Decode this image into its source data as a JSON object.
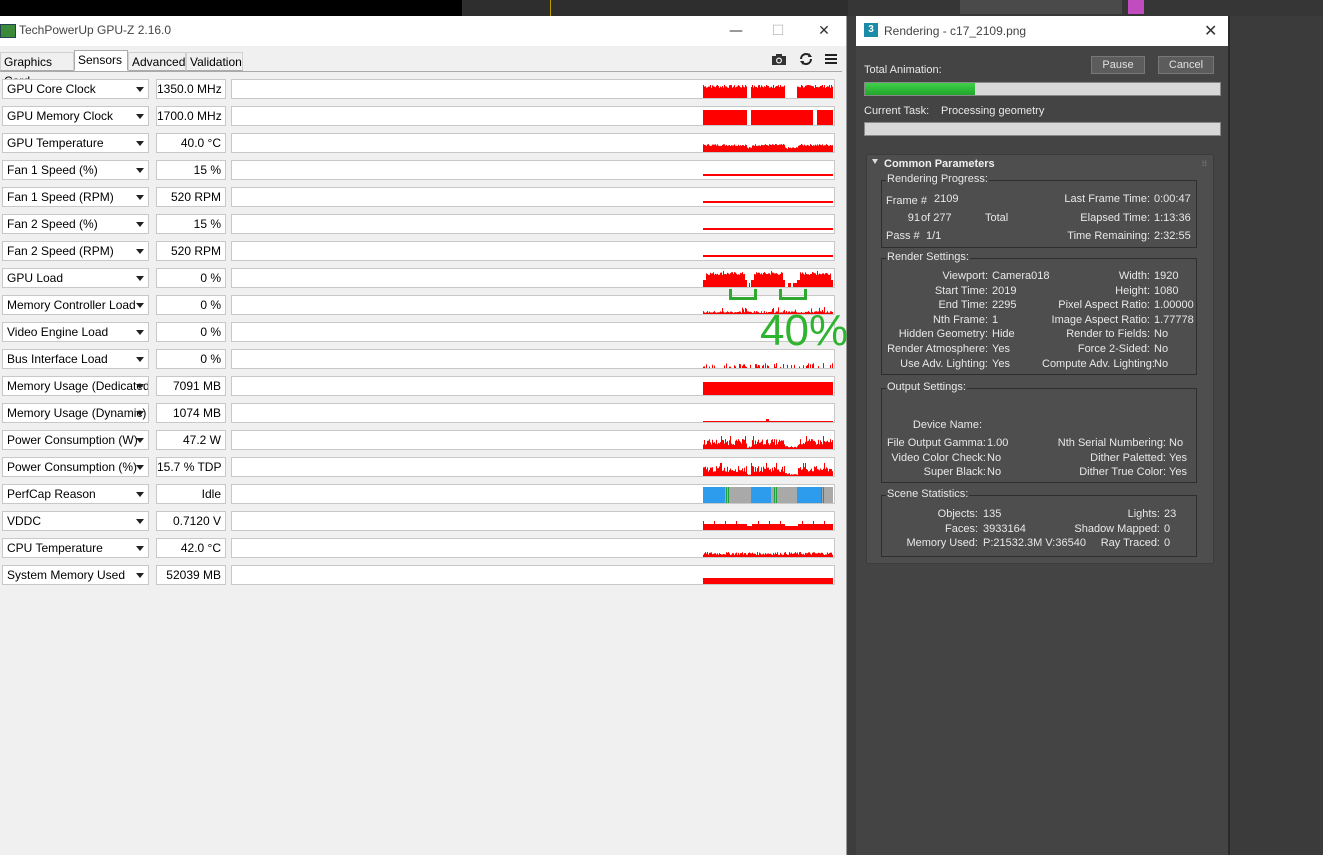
{
  "gpuz": {
    "title": "TechPowerUp GPU-Z 2.16.0",
    "window_buttons": {
      "minimize": "—",
      "maximize": "☐",
      "close": "✕"
    },
    "tabs": [
      {
        "label": "Graphics Card",
        "active": false
      },
      {
        "label": "Sensors",
        "active": true
      },
      {
        "label": "Advanced",
        "active": false
      },
      {
        "label": "Validation",
        "active": false
      }
    ],
    "toolbar_icons": [
      "camera-icon",
      "refresh-icon",
      "menu-icon"
    ],
    "graph_color": "#ff0000",
    "perfcap_colors": {
      "blue": "#2e9cec",
      "gray": "#a9a9a9",
      "green": "#20a040"
    },
    "sensors": [
      {
        "name": "GPU Core Clock",
        "value": "1350.0 MHz",
        "graph": "blocks"
      },
      {
        "name": "GPU Memory Clock",
        "value": "1700.0 MHz",
        "graph": "blocks_full"
      },
      {
        "name": "GPU Temperature",
        "value": "40.0 °C",
        "graph": "noisy_low"
      },
      {
        "name": "Fan 1 Speed (%)",
        "value": "15 %",
        "graph": "flat"
      },
      {
        "name": "Fan 1 Speed (RPM)",
        "value": "520 RPM",
        "graph": "flat"
      },
      {
        "name": "Fan 2 Speed (%)",
        "value": "15 %",
        "graph": "flat"
      },
      {
        "name": "Fan 2 Speed (RPM)",
        "value": "520 RPM",
        "graph": "flat"
      },
      {
        "name": "GPU Load",
        "value": "0 %",
        "graph": "load"
      },
      {
        "name": "Memory Controller Load",
        "value": "0 %",
        "graph": "memctl"
      },
      {
        "name": "Video Engine Load",
        "value": "0 %",
        "graph": "none"
      },
      {
        "name": "Bus Interface Load",
        "value": "0 %",
        "graph": "sparse"
      },
      {
        "name": "Memory Usage (Dedicated)",
        "value": "7091 MB",
        "graph": "solid_tall"
      },
      {
        "name": "Memory Usage (Dynamic)",
        "value": "1074 MB",
        "graph": "thin"
      },
      {
        "name": "Power Consumption (W)",
        "value": "47.2 W",
        "graph": "power"
      },
      {
        "name": "Power Consumption (%)",
        "value": "15.7 % TDP",
        "graph": "power"
      },
      {
        "name": "PerfCap Reason",
        "value": "Idle",
        "graph": "perfcap"
      },
      {
        "name": "VDDC",
        "value": "0.7120 V",
        "graph": "vddc"
      },
      {
        "name": "CPU Temperature",
        "value": "42.0 °C",
        "graph": "noisy_tiny"
      },
      {
        "name": "System Memory Used",
        "value": "52039 MB",
        "graph": "solid_mid"
      }
    ],
    "overlay_text": "40%",
    "overlay_color": "#2fb42f"
  },
  "render": {
    "title": "Rendering - c17_2109.png",
    "total_animation_label": "Total Animation:",
    "total_animation_progress": 0.31,
    "current_task_label": "Current Task:",
    "current_task_value": "Processing geometry",
    "current_task_progress": 0,
    "pause_label": "Pause",
    "cancel_label": "Cancel",
    "common_params_label": "Common Parameters",
    "rendering_progress": {
      "title": "Rendering Progress:",
      "frame_label": "Frame #",
      "frame_value": "2109",
      "count_value": "91",
      "count_of": "of 277",
      "total_label": "Total",
      "pass_label": "Pass #",
      "pass_value": "1/1",
      "last_frame_label": "Last Frame Time:",
      "last_frame_value": "0:00:47",
      "elapsed_label": "Elapsed Time:",
      "elapsed_value": "1:13:36",
      "remaining_label": "Time Remaining:",
      "remaining_value": "2:32:55"
    },
    "render_settings": {
      "title": "Render Settings:",
      "left": [
        {
          "k": "Viewport:",
          "v": "Camera018"
        },
        {
          "k": "Start Time:",
          "v": "2019"
        },
        {
          "k": "End Time:",
          "v": "2295"
        },
        {
          "k": "Nth Frame:",
          "v": "1"
        },
        {
          "k": "Hidden Geometry:",
          "v": "Hide"
        },
        {
          "k": "Render Atmosphere:",
          "v": "Yes"
        },
        {
          "k": "Use Adv. Lighting:",
          "v": "Yes"
        }
      ],
      "right": [
        {
          "k": "Width:",
          "v": "1920"
        },
        {
          "k": "Height:",
          "v": "1080"
        },
        {
          "k": "Pixel Aspect Ratio:",
          "v": "1.00000"
        },
        {
          "k": "Image Aspect Ratio:",
          "v": "1.77778"
        },
        {
          "k": "Render to Fields:",
          "v": "No"
        },
        {
          "k": "Force 2-Sided:",
          "v": "No"
        },
        {
          "k": "Compute Adv. Lighting:",
          "v": "No"
        }
      ]
    },
    "output_settings": {
      "title": "Output Settings:",
      "device_name_label": "Device Name:",
      "left": [
        {
          "k": "File Output Gamma:",
          "v": "1.00"
        },
        {
          "k": "Video Color Check:",
          "v": "No"
        },
        {
          "k": "Super Black:",
          "v": "No"
        }
      ],
      "right": [
        {
          "k": "Nth Serial Numbering:",
          "v": "No"
        },
        {
          "k": "Dither Paletted:",
          "v": "Yes"
        },
        {
          "k": "Dither True Color:",
          "v": "Yes"
        }
      ]
    },
    "scene_statistics": {
      "title": "Scene Statistics:",
      "left": [
        {
          "k": "Objects:",
          "v": "135"
        },
        {
          "k": "Faces:",
          "v": "3933164"
        },
        {
          "k": "Memory Used:",
          "v": "P:21532.3M V:36540"
        }
      ],
      "right": [
        {
          "k": "Lights:",
          "v": "23"
        },
        {
          "k": "Shadow Mapped:",
          "v": "0"
        },
        {
          "k": "Ray Traced:",
          "v": "0"
        }
      ]
    }
  }
}
